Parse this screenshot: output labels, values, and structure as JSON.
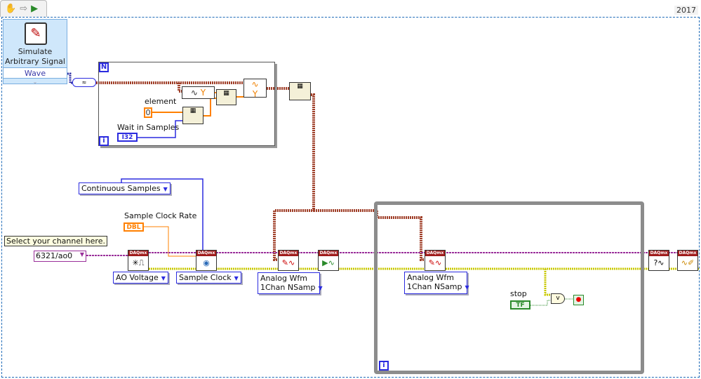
{
  "toolbar": {
    "icons": [
      "hand-icon",
      "arrow-icon",
      "run-icon"
    ]
  },
  "version": "2017",
  "express_vi": {
    "title_line1": "Simulate",
    "title_line2": "Arbitrary Signal",
    "output": "Wave",
    "icon": "signal-pen-icon"
  },
  "for_loop": {
    "count_terminal": "N",
    "iteration_terminal": "i",
    "element_label": "element",
    "element_value": "0",
    "wait_label": "Wait in Samples",
    "wait_type": "I32",
    "y_label": "Y"
  },
  "controls": {
    "sample_mode": "Continuous Samples",
    "rate_label": "Sample Clock Rate",
    "rate_type": "DBL",
    "channel_comment": "Select your channel here.",
    "channel_value": "6321/ao0"
  },
  "daqmx": {
    "header": "DAQmx",
    "create_channel": "AO Voltage",
    "timing": "Sample Clock",
    "write1_line1": "Analog Wfm",
    "write1_line2": "1Chan NSamp",
    "write2_line1": "Analog Wfm",
    "write2_line2": "1Chan NSamp"
  },
  "while_loop": {
    "iteration_terminal": "i",
    "stop_label": "stop",
    "stop_type": "TF",
    "or_label": "v"
  },
  "colors": {
    "waveform_wire": "#a0402a",
    "task_wire": "#9a2f9a",
    "error_wire": "#c8c800",
    "numeric_wire": "#ff8000",
    "enum_wire": "#2b2bdf",
    "bool_wire": "#2a8a2a",
    "loop_border": "#8c8c8c"
  }
}
